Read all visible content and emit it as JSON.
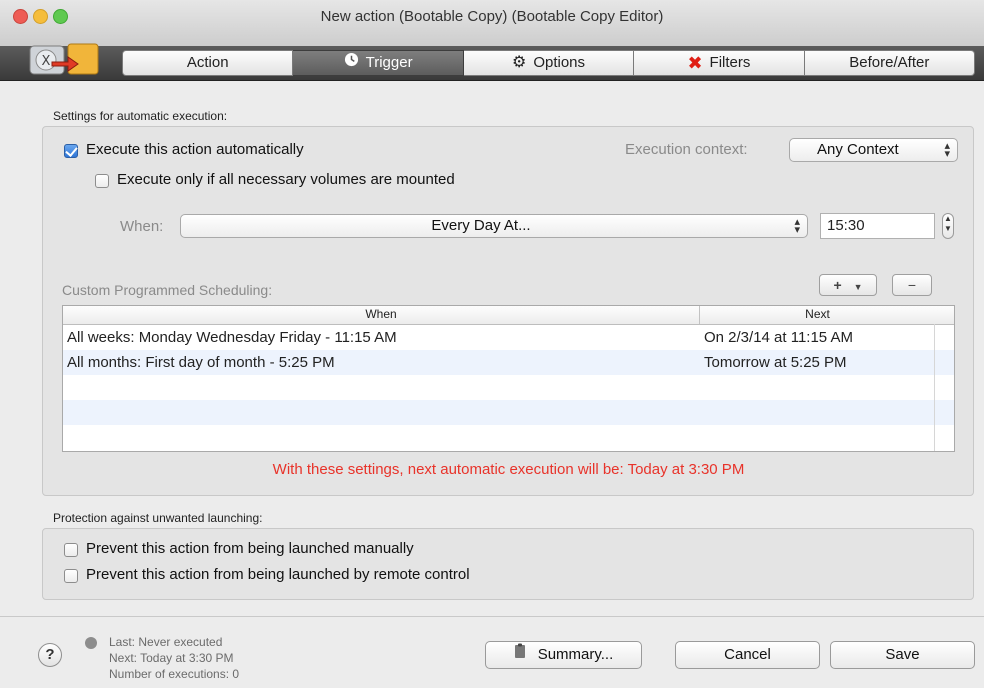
{
  "window": {
    "title": "New action (Bootable Copy) (Bootable Copy Editor)"
  },
  "tabs": [
    {
      "label": "Action",
      "icon": "none"
    },
    {
      "label": "Trigger",
      "icon": "clock-icon",
      "selected": true
    },
    {
      "label": "Options",
      "icon": "gear-icon"
    },
    {
      "label": "Filters",
      "icon": "red-x-icon"
    },
    {
      "label": "Before/After",
      "icon": "none"
    }
  ],
  "settings": {
    "group_label": "Settings for automatic execution:",
    "execute_auto_label": "Execute this action automatically",
    "execute_auto_checked": true,
    "execute_mounted_label": "Execute only if all necessary volumes are mounted",
    "execute_mounted_checked": false,
    "context_label": "Execution context:",
    "context_value": "Any Context",
    "when_label": "When:",
    "when_value": "Every Day At...",
    "time_value": "15:30",
    "custom_label": "Custom Programmed Scheduling:",
    "add_button": "+",
    "remove_button": "−",
    "table": {
      "columns": [
        "When",
        "Next"
      ],
      "rows": [
        {
          "when": "All weeks: Monday Wednesday Friday - 11:15 AM",
          "next": "On 2/3/14 at 11:15 AM"
        },
        {
          "when": "All months: First day of month - 5:25 PM",
          "next": "Tomorrow at 5:25 PM"
        }
      ]
    },
    "next_note": "With these settings, next automatic execution will be: Today at 3:30 PM"
  },
  "protection": {
    "group_label": "Protection against unwanted launching:",
    "manual_label": "Prevent this action from being launched manually",
    "remote_label": "Prevent this action from being launched by remote control"
  },
  "footer": {
    "help": "?",
    "last": "Last: Never executed",
    "next": "Next: Today at 3:30 PM",
    "count": "Number of executions: 0",
    "summary_button": "Summary...",
    "cancel_button": "Cancel",
    "save_button": "Save"
  },
  "colors": {
    "accent_red": "#e8332a",
    "selected_tab": "#5d5d5d"
  }
}
